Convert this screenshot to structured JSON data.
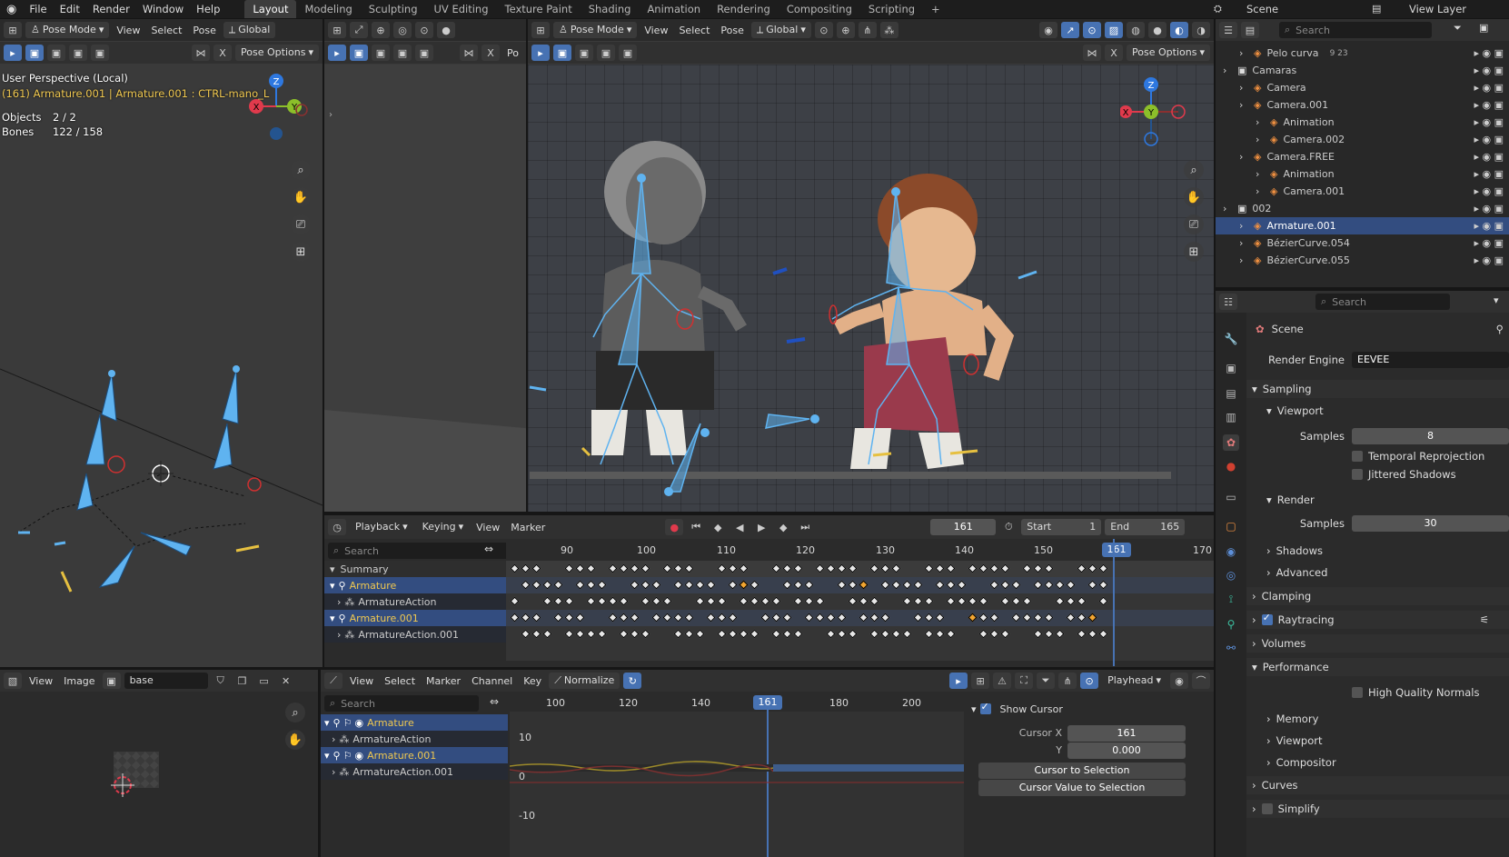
{
  "topbar": {
    "menus": [
      "File",
      "Edit",
      "Render",
      "Window",
      "Help"
    ],
    "tabs": [
      "Layout",
      "Modeling",
      "Sculpting",
      "UV Editing",
      "Texture Paint",
      "Shading",
      "Animation",
      "Rendering",
      "Compositing",
      "Scripting"
    ],
    "active_tab": "Layout",
    "scene_label": "Scene",
    "view_layer_label": "View Layer"
  },
  "viewport_left": {
    "mode": "Pose Mode",
    "menus": [
      "View",
      "Select",
      "Pose"
    ],
    "orientation": "Global",
    "pose_options": "Pose Options",
    "info_perspective": "User Perspective (Local)",
    "info_object": "(161) Armature.001 | Armature.001 : CTRL-mano_L",
    "objects_label": "Objects",
    "objects_value": "2 / 2",
    "bones_label": "Bones",
    "bones_value": "122 / 158",
    "axis_x": "X",
    "axis_y": "Y",
    "axis_z": "Z"
  },
  "viewport_mid": {
    "pose_options_short": "Po"
  },
  "viewport_main": {
    "mode": "Pose Mode",
    "menus": [
      "View",
      "Select",
      "Pose"
    ],
    "orientation": "Global",
    "pose_options": "Pose Options",
    "axis_x": "X",
    "axis_y": "Y",
    "axis_z": "Z"
  },
  "dopesheet": {
    "menus": [
      "Playback",
      "Keying",
      "View",
      "Marker"
    ],
    "current_frame": "161",
    "start_label": "Start",
    "start": "1",
    "end_label": "End",
    "end": "165",
    "search_placeholder": "Search",
    "ruler": [
      "90",
      "100",
      "110",
      "120",
      "130",
      "140",
      "150",
      "160",
      "170"
    ],
    "playhead": "161",
    "channels": [
      "Summary",
      "Armature",
      "ArmatureAction",
      "Armature.001",
      "ArmatureAction.001"
    ]
  },
  "image_editor": {
    "menus": [
      "View",
      "Image"
    ],
    "image_name": "base"
  },
  "graph_editor": {
    "menus": [
      "View",
      "Select",
      "Marker",
      "Channel",
      "Key"
    ],
    "normalize": "Normalize",
    "pivot": "Playhead",
    "search_placeholder": "Search",
    "ruler": [
      "100",
      "120",
      "140",
      "161",
      "180",
      "200"
    ],
    "yticks": [
      "10",
      "0",
      "-10"
    ],
    "channels": [
      "Armature",
      "ArmatureAction",
      "Armature.001",
      "ArmatureAction.001"
    ],
    "show_cursor": "Show Cursor",
    "cursor_x_label": "Cursor X",
    "cursor_x": "161",
    "cursor_y_label": "Y",
    "cursor_y": "0.000",
    "btn_cursor_sel": "Cursor to Selection",
    "btn_cursor_val": "Cursor Value to Selection"
  },
  "outliner": {
    "search_placeholder": "Search",
    "items": [
      {
        "label": "Pelo curva",
        "extra": "9 23",
        "indent": 1
      },
      {
        "label": "Camaras",
        "indent": 0
      },
      {
        "label": "Camera",
        "indent": 1
      },
      {
        "label": "Camera.001",
        "indent": 1
      },
      {
        "label": "Animation",
        "indent": 2
      },
      {
        "label": "Camera.002",
        "indent": 2
      },
      {
        "label": "Camera.FREE",
        "indent": 1
      },
      {
        "label": "Animation",
        "indent": 2
      },
      {
        "label": "Camera.001",
        "indent": 2
      },
      {
        "label": "002",
        "indent": 0
      },
      {
        "label": "Armature.001",
        "indent": 1,
        "selected": true
      },
      {
        "label": "BézierCurve.054",
        "indent": 1
      },
      {
        "label": "BézierCurve.055",
        "indent": 1
      }
    ]
  },
  "properties": {
    "search_placeholder": "Search",
    "scene_label": "Scene",
    "render_engine_label": "Render Engine",
    "render_engine": "EEVEE",
    "sampling": "Sampling",
    "viewport": "Viewport",
    "samples_label": "Samples",
    "viewport_samples": "8",
    "temporal_reprojection": "Temporal Reprojection",
    "jittered_shadows": "Jittered Shadows",
    "render": "Render",
    "render_samples": "30",
    "shadows": "Shadows",
    "advanced": "Advanced",
    "clamping": "Clamping",
    "raytracing": "Raytracing",
    "volumes": "Volumes",
    "performance": "Performance",
    "high_quality_normals": "High Quality Normals",
    "memory": "Memory",
    "viewport2": "Viewport",
    "compositor": "Compositor",
    "curves": "Curves",
    "simplify": "Simplify"
  },
  "colors": {
    "accent": "#4772b3",
    "selected_row": "#334d80",
    "bone": "#5fb3f0",
    "keyframe_sel": "#f2a531"
  }
}
